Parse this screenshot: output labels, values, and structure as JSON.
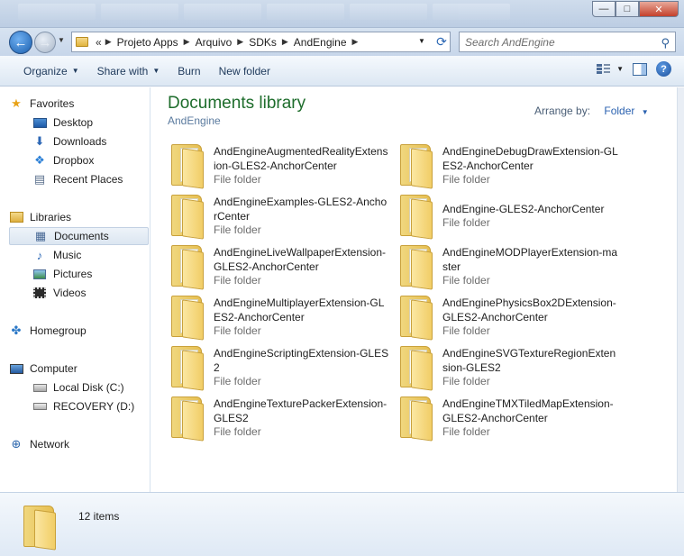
{
  "window": {
    "controls": {
      "minimize": "—",
      "maximize": "□",
      "close": "✕"
    }
  },
  "address": {
    "overflow": "«",
    "crumbs": [
      "Projeto Apps",
      "Arquivo",
      "SDKs",
      "AndEngine"
    ],
    "search_placeholder": "Search AndEngine"
  },
  "toolbar": {
    "organize": "Organize",
    "share_with": "Share with",
    "burn": "Burn",
    "new_folder": "New folder",
    "help": "?"
  },
  "nav": {
    "favorites": "Favorites",
    "desktop": "Desktop",
    "downloads": "Downloads",
    "dropbox": "Dropbox",
    "recent_places": "Recent Places",
    "libraries": "Libraries",
    "documents": "Documents",
    "music": "Music",
    "pictures": "Pictures",
    "videos": "Videos",
    "homegroup": "Homegroup",
    "computer": "Computer",
    "local_disk": "Local Disk (C:)",
    "recovery": "RECOVERY (D:)",
    "network": "Network"
  },
  "content": {
    "title": "Documents library",
    "subtitle": "AndEngine",
    "arrange_label": "Arrange by:",
    "arrange_value": "Folder",
    "items": [
      {
        "name": "AndEngineAugmentedRealityExtension-GLES2-AnchorCenter",
        "type": "File folder"
      },
      {
        "name": "AndEngineDebugDrawExtension-GLES2-AnchorCenter",
        "type": "File folder"
      },
      {
        "name": "AndEngineExamples-GLES2-AnchorCenter",
        "type": "File folder"
      },
      {
        "name": "AndEngine-GLES2-AnchorCenter",
        "type": "File folder"
      },
      {
        "name": "AndEngineLiveWallpaperExtension-GLES2-AnchorCenter",
        "type": "File folder"
      },
      {
        "name": "AndEngineMODPlayerExtension-master",
        "type": "File folder"
      },
      {
        "name": "AndEngineMultiplayerExtension-GLES2-AnchorCenter",
        "type": "File folder"
      },
      {
        "name": "AndEnginePhysicsBox2DExtension-GLES2-AnchorCenter",
        "type": "File folder"
      },
      {
        "name": "AndEngineScriptingExtension-GLES2",
        "type": "File folder"
      },
      {
        "name": "AndEngineSVGTextureRegionExtension-GLES2",
        "type": "File folder"
      },
      {
        "name": "AndEngineTexturePackerExtension-GLES2",
        "type": "File folder"
      },
      {
        "name": "AndEngineTMXTiledMapExtension-GLES2-AnchorCenter",
        "type": "File folder"
      }
    ]
  },
  "details": {
    "item_count": "12 items"
  }
}
